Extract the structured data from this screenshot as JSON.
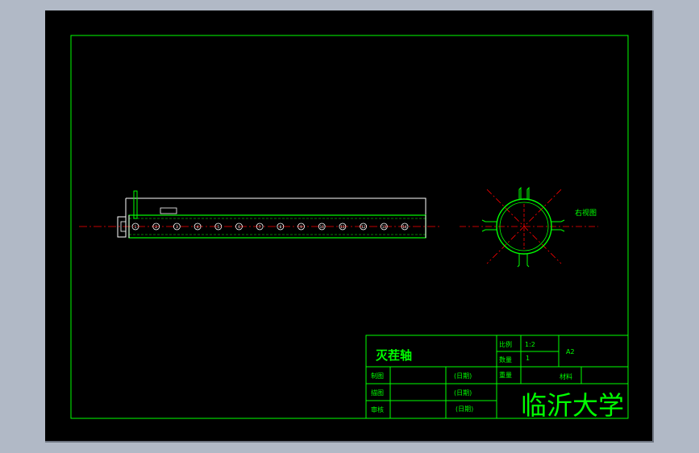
{
  "drawing": {
    "view_label": "右视图",
    "part_name": "灭茬轴",
    "dims": {
      "length_mark": "",
      "tab_mark": ""
    }
  },
  "title_block": {
    "scale_label": "比例",
    "scale_value": "1:2",
    "quantity_label": "数量",
    "quantity_value": "1",
    "weight_label": "重量",
    "material_label": "材料",
    "drawing_no": "A2",
    "drawn_label": "制图",
    "checked_label": "描图",
    "approved_label": "审核",
    "date_label": "(日期)",
    "institution": "临沂大学"
  },
  "colors": {
    "frame": "#00ff00",
    "outline": "#ffffff",
    "centerline": "#ff0000",
    "part": "#00ff00",
    "background": "#000000"
  },
  "bolt_holes": [
    "1",
    "2",
    "3",
    "4",
    "5",
    "6",
    "7",
    "8",
    "9",
    "10",
    "11",
    "12",
    "13",
    "14"
  ]
}
